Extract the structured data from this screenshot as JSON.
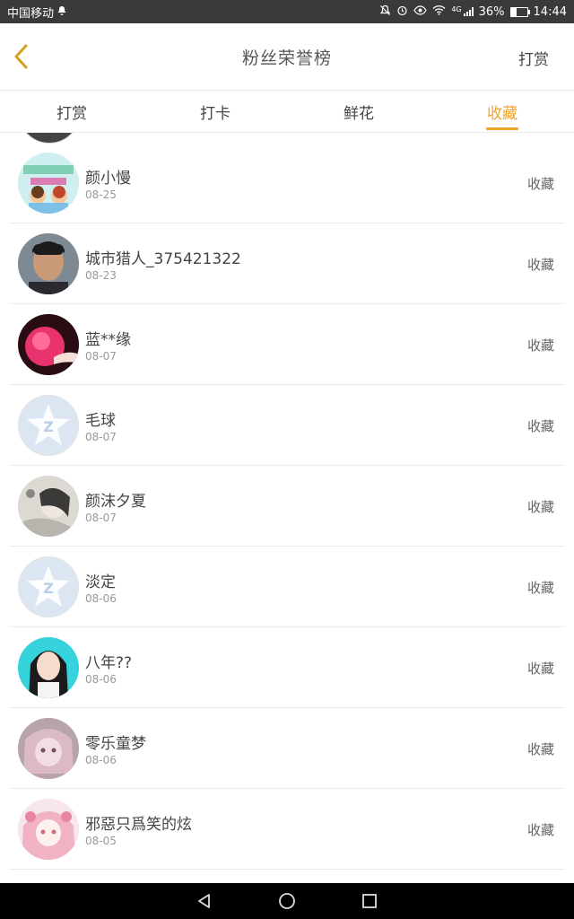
{
  "status": {
    "carrier": "中国移动",
    "battery": "36%",
    "battery_level": 0.36,
    "time": "14:44",
    "network": "4G"
  },
  "header": {
    "title": "粉丝荣誉榜",
    "right_button": "打赏"
  },
  "tabs": [
    {
      "label": "打赏",
      "active": false
    },
    {
      "label": "打卡",
      "active": false
    },
    {
      "label": "鲜花",
      "active": false
    },
    {
      "label": "收藏",
      "active": true
    }
  ],
  "accent_color": "#f0a22a",
  "rows": [
    {
      "name": "颜小慢",
      "date": "08-25",
      "action": "收藏",
      "avatar": "cartoon-avatar"
    },
    {
      "name": "城市猎人_375421322",
      "date": "08-23",
      "action": "收藏",
      "avatar": "photo-avatar"
    },
    {
      "name": "蓝**缘",
      "date": "08-07",
      "action": "收藏",
      "avatar": "pink-avatar"
    },
    {
      "name": "毛球",
      "date": "08-07",
      "action": "收藏",
      "avatar": "default-qq-avatar"
    },
    {
      "name": "颜沫夕夏",
      "date": "08-07",
      "action": "收藏",
      "avatar": "sketch-avatar"
    },
    {
      "name": "淡定",
      "date": "08-06",
      "action": "收藏",
      "avatar": "default-qq-avatar"
    },
    {
      "name": "八年??",
      "date": "08-06",
      "action": "收藏",
      "avatar": "girl-avatar"
    },
    {
      "name": "零乐童梦",
      "date": "08-06",
      "action": "收藏",
      "avatar": "anime-avatar"
    },
    {
      "name": "邪惡只爲笑的炫",
      "date": "08-05",
      "action": "收藏",
      "avatar": "anime-pink-avatar"
    }
  ]
}
